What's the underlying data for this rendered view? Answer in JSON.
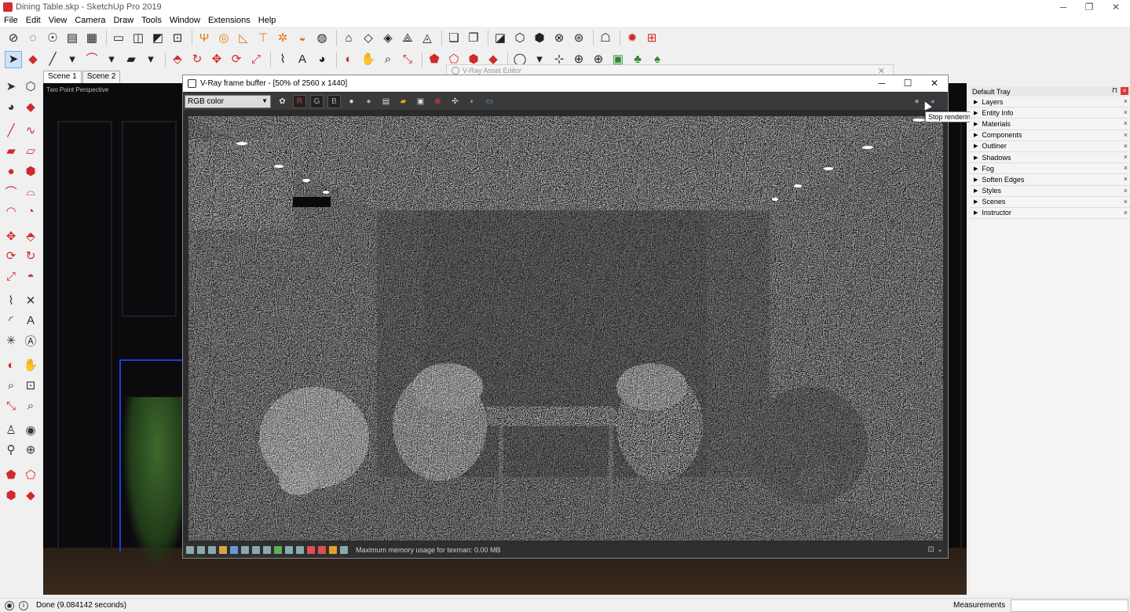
{
  "window": {
    "title": "Dining Table.skp - SketchUp Pro 2019",
    "minimize": "─",
    "restore": "❐",
    "close": "✕"
  },
  "menu": [
    "File",
    "Edit",
    "View",
    "Camera",
    "Draw",
    "Tools",
    "Window",
    "Extensions",
    "Help"
  ],
  "scenes": {
    "tab1": "Scene 1",
    "tab2": "Scene 2"
  },
  "viewport": {
    "camera_label": "Two Point Perspective"
  },
  "asset_editor": {
    "title": "V-Ray Asset Editor",
    "close": "✕"
  },
  "vfb": {
    "title": "V-Ray frame buffer - [50% of 2560 x 1440]",
    "minimize": "─",
    "maximize": "☐",
    "close": "✕",
    "channel": "RGB color",
    "r": "R",
    "g": "G",
    "b": "B",
    "status": "Maximum memory usage for texman: 0.00 MB"
  },
  "tooltip": "Stop rendering",
  "tray": {
    "title": "Default Tray",
    "pin": "⊓",
    "close": "×",
    "items": [
      "Layers",
      "Entity Info",
      "Materials",
      "Components",
      "Outliner",
      "Shadows",
      "Fog",
      "Soften Edges",
      "Styles",
      "Scenes",
      "Instructor"
    ]
  },
  "status": {
    "message": "Done (9.084142 seconds)",
    "measurements": "Measurements"
  }
}
